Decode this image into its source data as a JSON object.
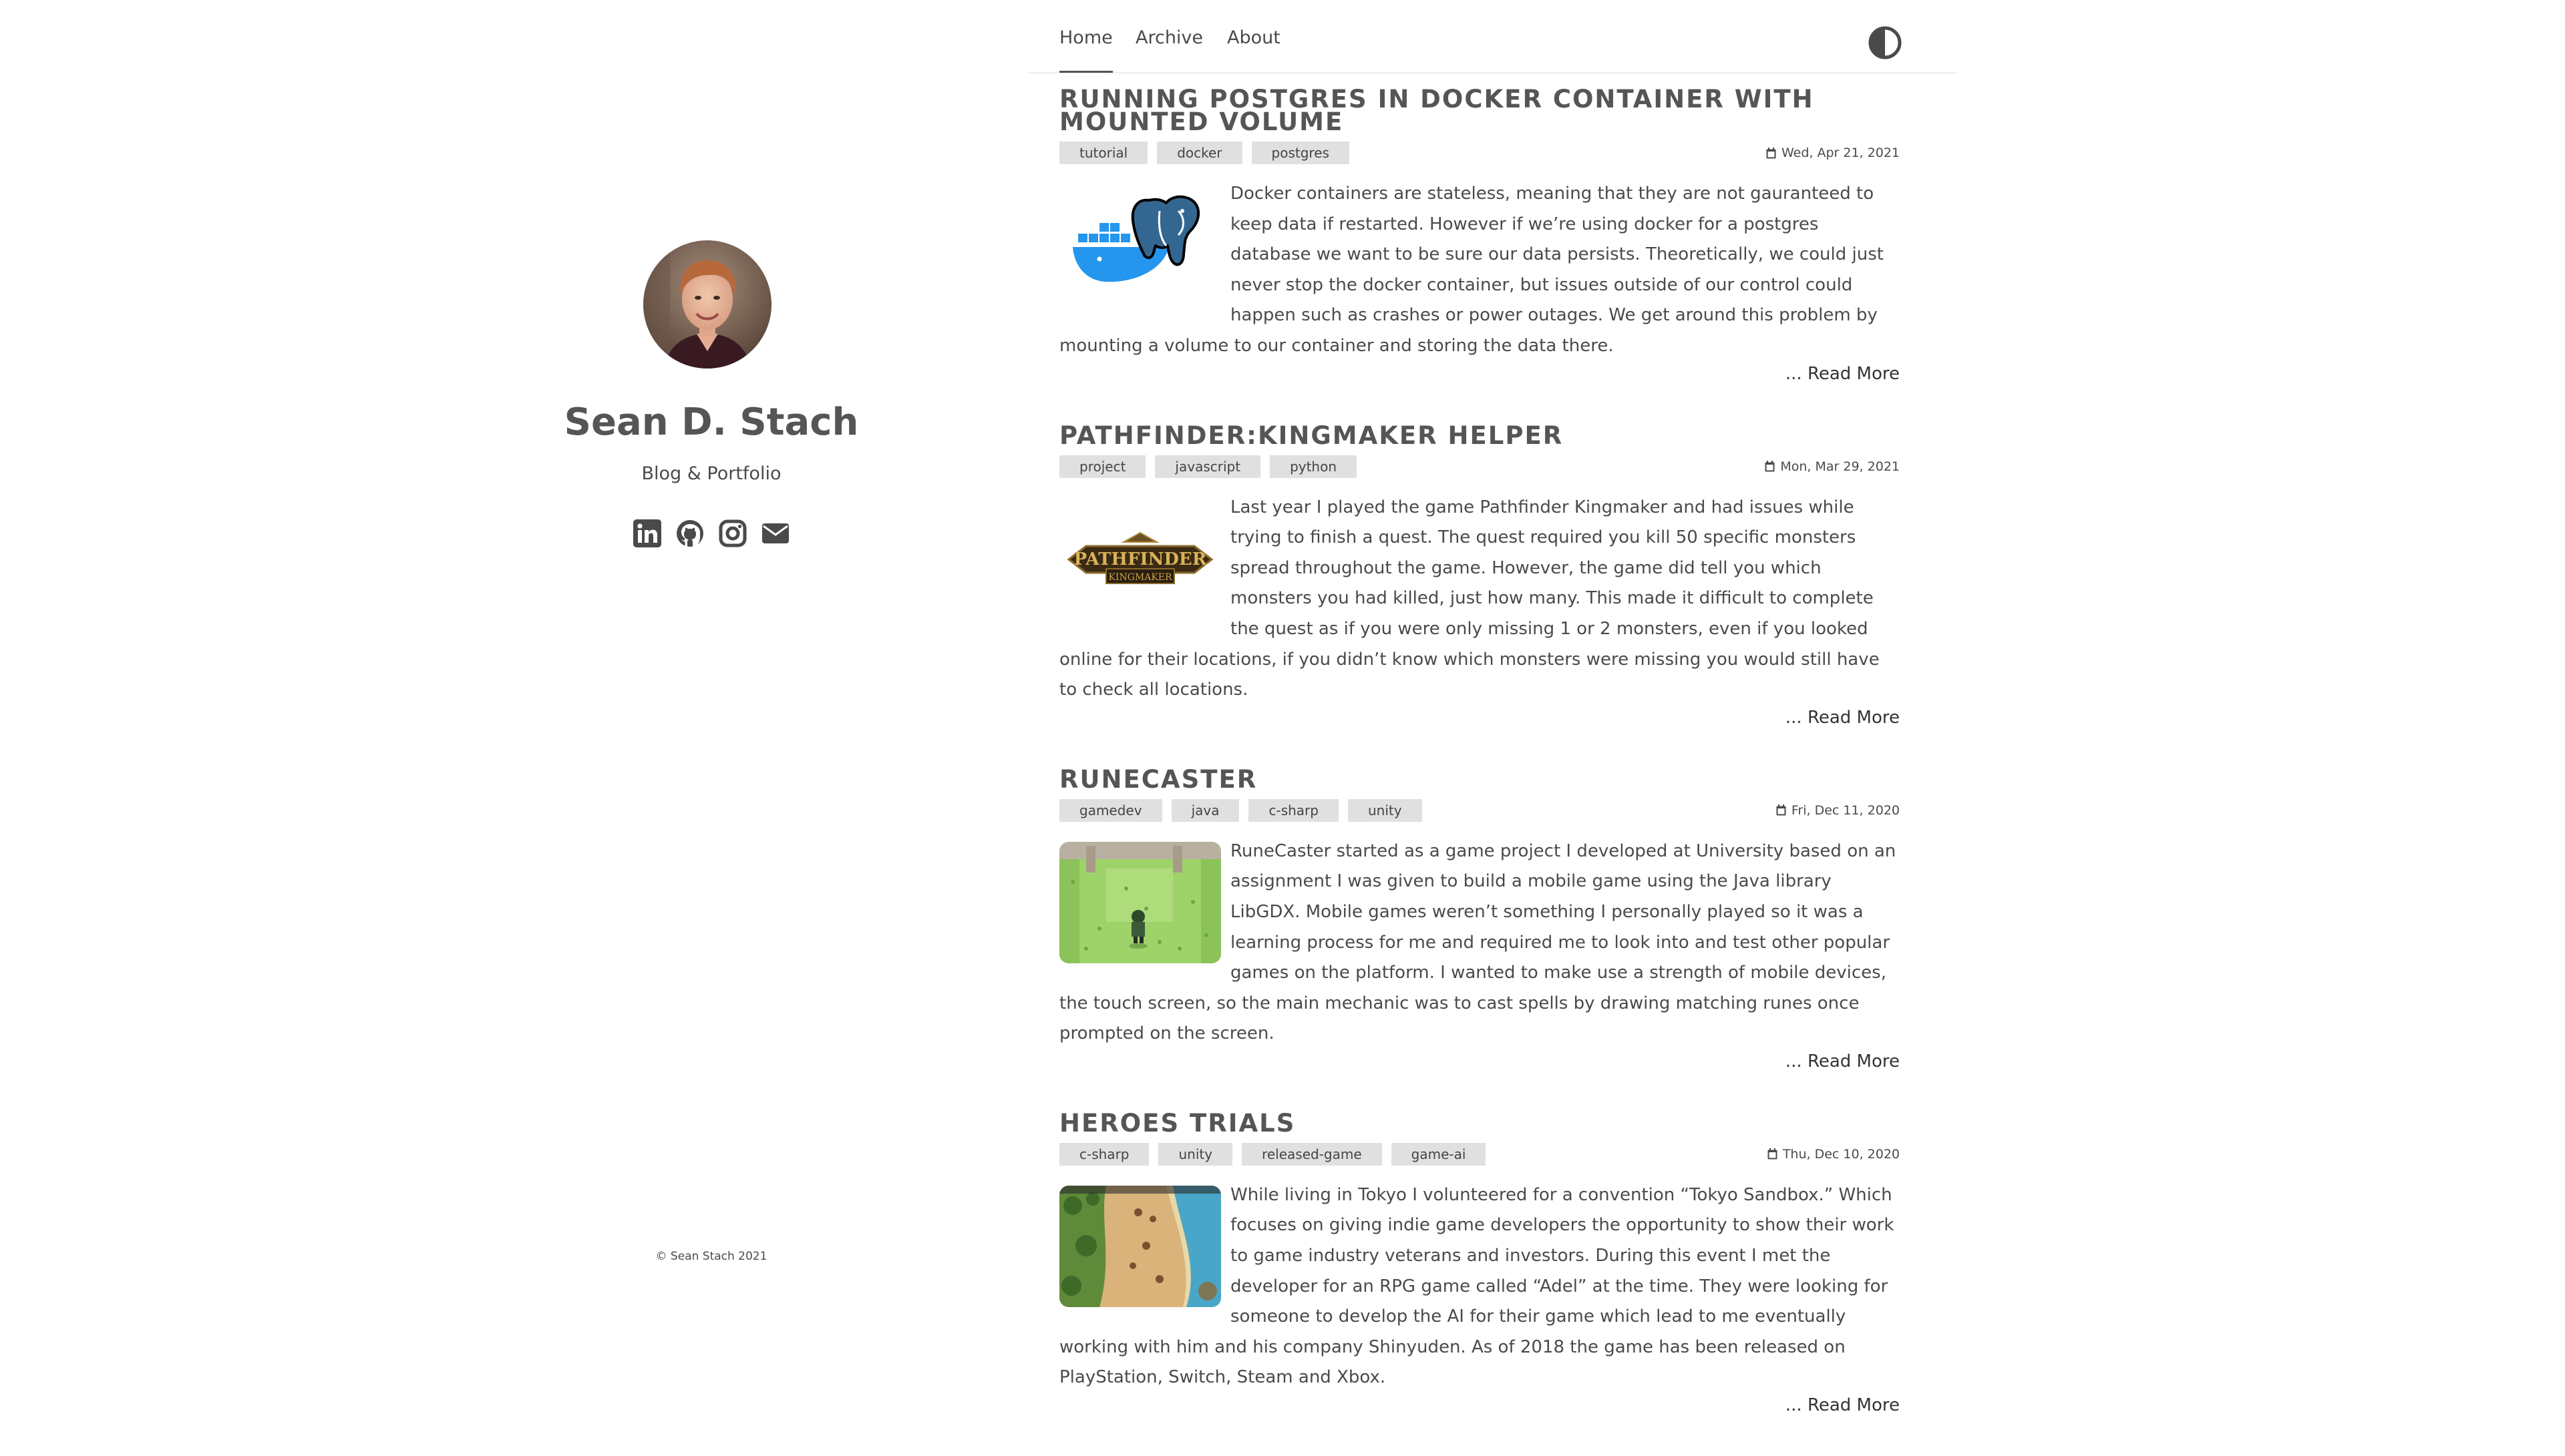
{
  "profile": {
    "name": "Sean D. Stach",
    "tagline": "Blog & Portfolio",
    "avatar_icon": "profile-photo",
    "socials": [
      {
        "icon": "linkedin-icon"
      },
      {
        "icon": "github-icon"
      },
      {
        "icon": "instagram-icon"
      },
      {
        "icon": "email-icon"
      }
    ],
    "copyright": "© Sean Stach 2021"
  },
  "nav": {
    "items": [
      {
        "label": "Home",
        "active": true
      },
      {
        "label": "Archive",
        "active": false
      },
      {
        "label": "About",
        "active": false
      }
    ],
    "theme_toggle_icon": "contrast-icon"
  },
  "posts": [
    {
      "title": "RUNNING POSTGRES IN DOCKER CONTAINER WITH MOUNTED VOLUME",
      "tags": [
        "tutorial",
        "docker",
        "postgres"
      ],
      "date": "Wed, Apr 21, 2021",
      "thumbnail": "docker-postgres-logo",
      "body": "Docker containers are stateless, meaning that they are not gauranteed to keep data if restarted. However if we’re using docker for a postgres database we want to be sure our data persists. Theoretically, we could just never stop the docker container, but issues outside of our control could happen such as crashes or power outages. We get around this problem by mounting a volume to our container and storing the data there.",
      "read_more": "... Read More"
    },
    {
      "title": "PATHFINDER:KINGMAKER HELPER",
      "tags": [
        "project",
        "javascript",
        "python"
      ],
      "date": "Mon, Mar 29, 2021",
      "thumbnail": "pathfinder-kingmaker-logo",
      "logo_text": {
        "line1": "PATHFINDER",
        "line2": "KINGMAKER"
      },
      "body": "Last year I played the game Pathfinder Kingmaker and had issues while trying to finish a quest. The quest required you kill 50 specific monsters spread throughout the game. However, the game did tell you which monsters you had killed, just how many. This made it difficult to complete the quest as if you were only missing 1 or 2 monsters, even if you looked online for their locations, if you didn’t know which monsters were missing you would still have to check all locations.",
      "read_more": "... Read More"
    },
    {
      "title": "RUNECASTER",
      "tags": [
        "gamedev",
        "java",
        "c-sharp",
        "unity"
      ],
      "date": "Fri, Dec 11, 2020",
      "thumbnail": "runecaster-screenshot",
      "body": "RuneCaster started as a game project I developed at University based on an assignment I was given to build a mobile game using the Java library LibGDX. Mobile games weren’t something I personally played so it was a learning process for me and required me to look into and test other popular games on the platform. I wanted to make use a strength of mobile devices, the touch screen, so the main mechanic was to cast spells by drawing matching runes once prompted on the screen.",
      "read_more": "... Read More"
    },
    {
      "title": "HEROES TRIALS",
      "tags": [
        "c-sharp",
        "unity",
        "released-game",
        "game-ai"
      ],
      "date": "Thu, Dec 10, 2020",
      "thumbnail": "heroes-trials-screenshot",
      "body": "While living in Tokyo I volunteered for a convention “Tokyo Sandbox.” Which focuses on giving indie game developers the opportunity to show their work to game industry veterans and investors. During this event I met the developer for an RPG game called “Adel” at the time. They were looking for someone to develop the AI for their game which lead to me eventually working with him and his company Shinyuden. As of 2018 the game has been released on PlayStation, Switch, Steam and Xbox.",
      "read_more": "... Read More"
    }
  ]
}
